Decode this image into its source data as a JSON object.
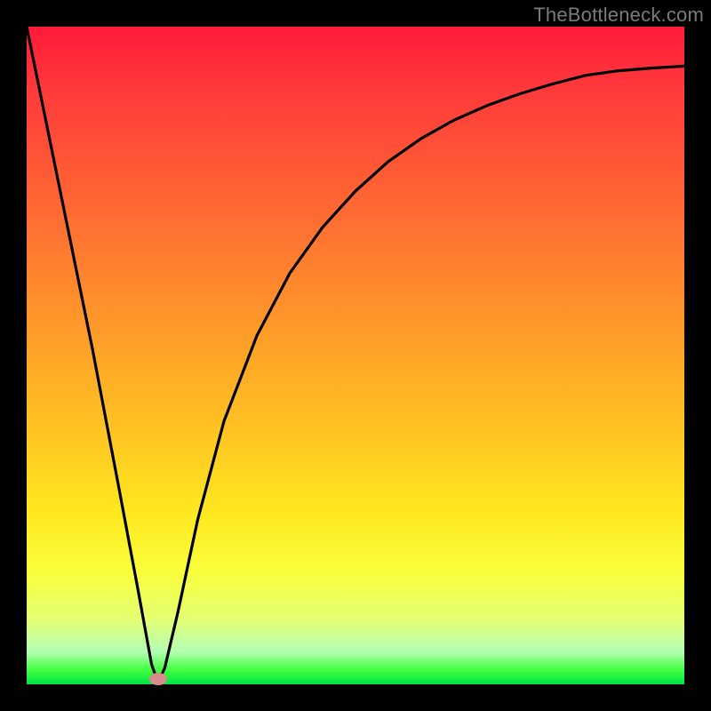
{
  "watermark": "TheBottleneck.com",
  "marker": {
    "x_frac": 0.2,
    "y_frac": 0.992
  },
  "chart_data": {
    "type": "line",
    "title": "",
    "xlabel": "",
    "ylabel": "",
    "xlim": [
      0,
      1
    ],
    "ylim": [
      0,
      1
    ],
    "series": [
      {
        "name": "bottleneck-curve",
        "x": [
          0.0,
          0.05,
          0.1,
          0.14,
          0.17,
          0.19,
          0.2,
          0.21,
          0.23,
          0.26,
          0.3,
          0.35,
          0.4,
          0.45,
          0.5,
          0.55,
          0.6,
          0.65,
          0.7,
          0.75,
          0.8,
          0.85,
          0.9,
          0.95,
          1.0
        ],
        "y": [
          1.0,
          0.755,
          0.51,
          0.3,
          0.14,
          0.03,
          0.003,
          0.025,
          0.11,
          0.25,
          0.4,
          0.53,
          0.625,
          0.695,
          0.75,
          0.795,
          0.83,
          0.858,
          0.88,
          0.898,
          0.913,
          0.926,
          0.933,
          0.937,
          0.94
        ]
      }
    ],
    "markers": [
      {
        "name": "current-point",
        "x": 0.2,
        "y": 0.008
      }
    ],
    "gradient_stops": [
      {
        "pos": 0.0,
        "color": "#ff1a3a"
      },
      {
        "pos": 0.5,
        "color": "#ffb726"
      },
      {
        "pos": 0.8,
        "color": "#fff838"
      },
      {
        "pos": 0.95,
        "color": "#b4ffb4"
      },
      {
        "pos": 1.0,
        "color": "#00e048"
      }
    ]
  }
}
